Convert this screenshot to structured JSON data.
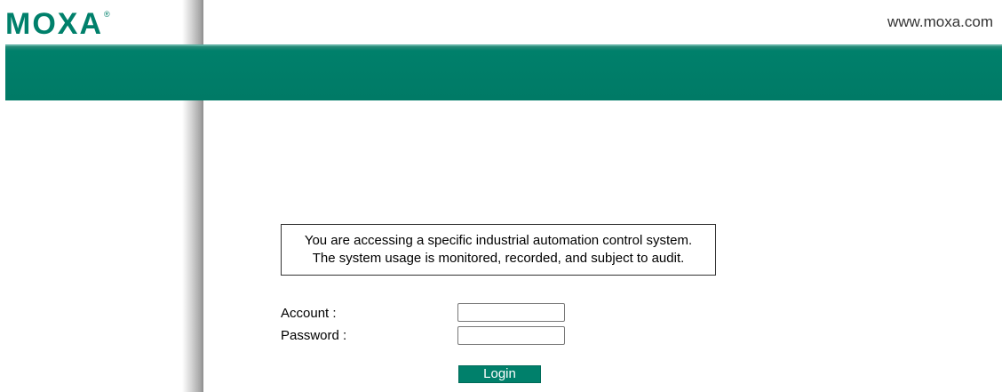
{
  "header": {
    "logo_text": "MOXA",
    "logo_reg": "®",
    "site_url": "www.moxa.com"
  },
  "notice": {
    "line1": "You are accessing a specific industrial automation control system.",
    "line2": "The system usage is monitored, recorded, and subject to audit."
  },
  "form": {
    "account_label": "Account :",
    "account_value": "",
    "password_label": "Password :",
    "password_value": "",
    "login_label": "Login"
  },
  "colors": {
    "brand_green": "#00806b",
    "text": "#000000",
    "url_text": "#333333"
  }
}
